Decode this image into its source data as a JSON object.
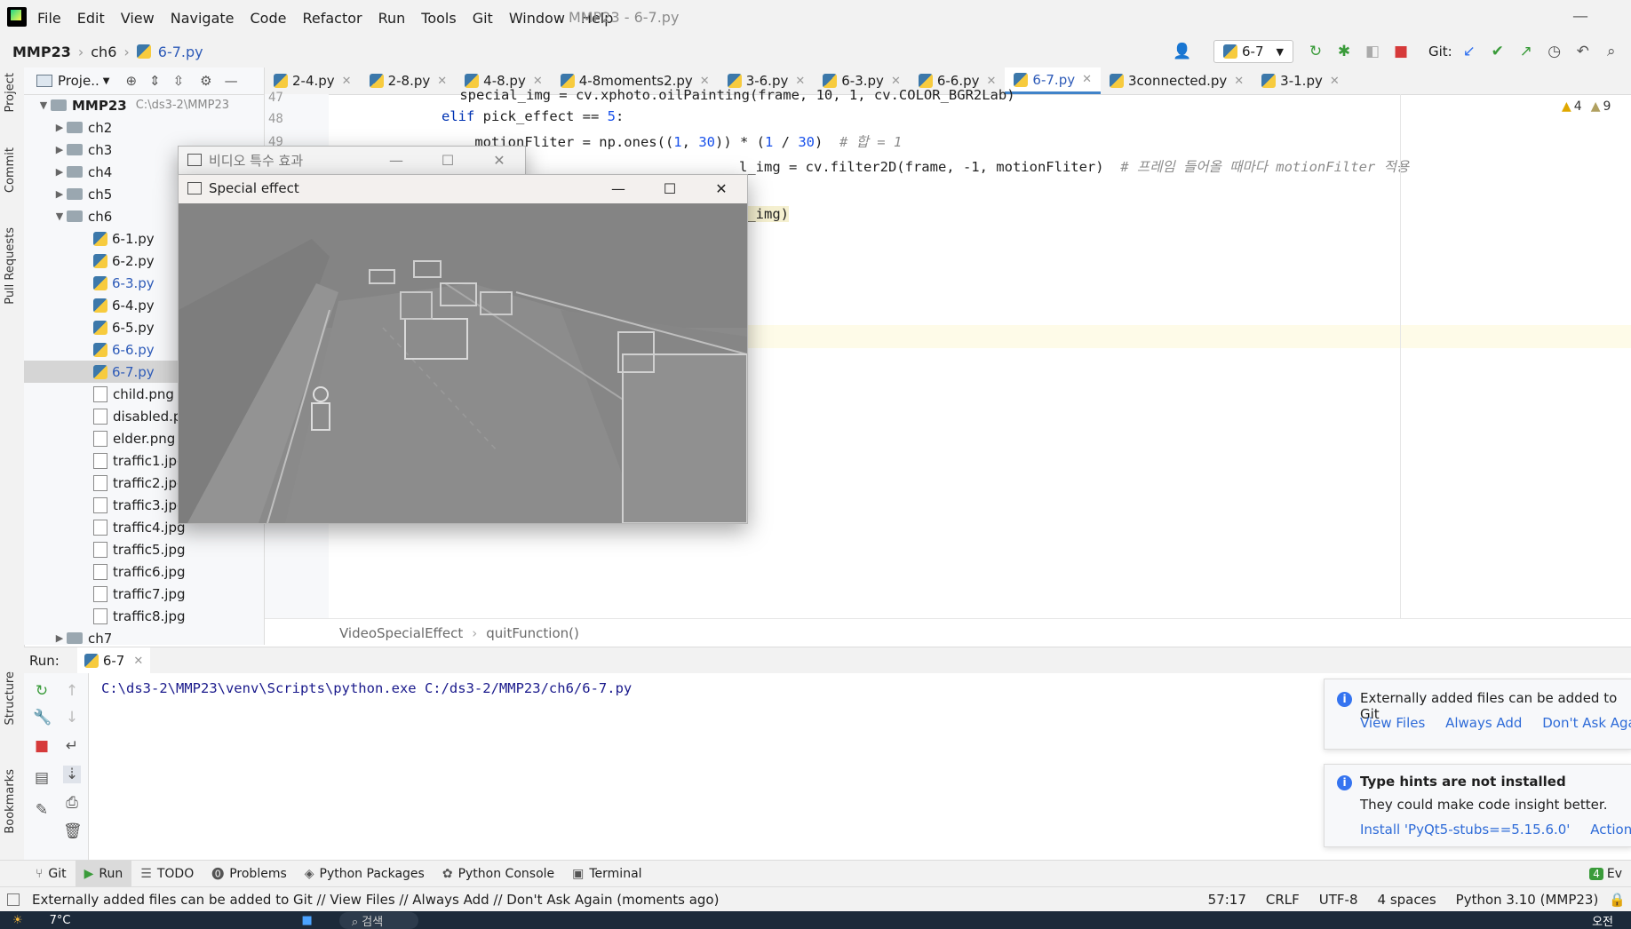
{
  "menubar": {
    "items": [
      "File",
      "Edit",
      "View",
      "Navigate",
      "Code",
      "Refactor",
      "Run",
      "Tools",
      "Git",
      "Window",
      "Help"
    ],
    "window_title": "MMP23 - 6-7.py"
  },
  "navbar": {
    "crumbs": [
      "MMP23",
      "ch6",
      "6-7.py"
    ],
    "run_config": "6-7",
    "git_label": "Git:"
  },
  "left_strip": {
    "project": "Project",
    "commit": "Commit",
    "pull_requests": "Pull Requests",
    "structure": "Structure",
    "bookmarks": "Bookmarks"
  },
  "project_panel": {
    "title": "Proje..",
    "root": {
      "name": "MMP23",
      "path": "C:\\ds3-2\\MMP23"
    },
    "folders_top": [
      "ch2",
      "ch3",
      "ch4",
      "ch5",
      "ch6"
    ],
    "files": [
      {
        "name": "6-1.py",
        "kind": "py",
        "modified": false
      },
      {
        "name": "6-2.py",
        "kind": "py",
        "modified": false
      },
      {
        "name": "6-3.py",
        "kind": "py",
        "modified": true
      },
      {
        "name": "6-4.py",
        "kind": "py",
        "modified": false
      },
      {
        "name": "6-5.py",
        "kind": "py",
        "modified": false
      },
      {
        "name": "6-6.py",
        "kind": "py",
        "modified": true
      },
      {
        "name": "6-7.py",
        "kind": "py",
        "modified": true,
        "selected": true
      },
      {
        "name": "child.png",
        "kind": "img",
        "modified": false
      },
      {
        "name": "disabled.pr",
        "kind": "img",
        "modified": false
      },
      {
        "name": "elder.png",
        "kind": "img",
        "modified": false
      },
      {
        "name": "traffic1.jpg",
        "kind": "img",
        "modified": false
      },
      {
        "name": "traffic2.jpg",
        "kind": "img",
        "modified": false
      },
      {
        "name": "traffic3.jpg",
        "kind": "img",
        "modified": false
      },
      {
        "name": "traffic4.jpg",
        "kind": "img",
        "modified": false
      },
      {
        "name": "traffic5.jpg",
        "kind": "img",
        "modified": false
      },
      {
        "name": "traffic6.jpg",
        "kind": "img",
        "modified": false
      },
      {
        "name": "traffic7.jpg",
        "kind": "img",
        "modified": false
      },
      {
        "name": "traffic8.jpg",
        "kind": "img",
        "modified": false
      }
    ],
    "folder_bottom": "ch7"
  },
  "tabs": [
    {
      "label": "2-4.py",
      "active": false
    },
    {
      "label": "2-8.py",
      "active": false
    },
    {
      "label": "4-8.py",
      "active": false
    },
    {
      "label": "4-8moments2.py",
      "active": false
    },
    {
      "label": "3-6.py",
      "active": false
    },
    {
      "label": "6-3.py",
      "active": false
    },
    {
      "label": "6-6.py",
      "active": false
    },
    {
      "label": "6-7.py",
      "active": true
    },
    {
      "label": "3connected.py",
      "active": false
    },
    {
      "label": "3-1.py",
      "active": false
    }
  ],
  "editor": {
    "line_numbers": [
      "47",
      "48",
      "49"
    ],
    "lines": {
      "l47": "    special_img = cv.xphoto.oilPainting(frame, 10, 1, cv.COLOR_BGR2Lab)",
      "l48_kw": "elif",
      "l48_rest": " pick_effect == ",
      "l48_num": "5",
      "l48_end": ":",
      "l49_a": "    motionFliter = np.ones((",
      "l49_n1": "1",
      "l49_b": ", ",
      "l49_n2": "30",
      "l49_c": ")) * (",
      "l49_n3": "1",
      "l49_d": " / ",
      "l49_n4": "30",
      "l49_e": ")  ",
      "l49_cmt": "# 합 = 1",
      "l50_a": "l_img = cv.filter2D(frame, -1, motionFliter)  ",
      "l50_cmt": "# 프레임 들어올 때마다 motionFilter 적용",
      "l52": "l_img)"
    },
    "warnings": "4",
    "weak_warnings": "9"
  },
  "editor_breadcrumb": [
    "VideoSpecialEffect",
    "quitFunction()"
  ],
  "window_back": {
    "title": "비디오 특수 효과"
  },
  "window_front": {
    "title": "Special effect"
  },
  "run_panel": {
    "label": "Run:",
    "tab": "6-7",
    "command": "C:\\ds3-2\\MMP23\\venv\\Scripts\\python.exe C:/ds3-2/MMP23/ch6/6-7.py"
  },
  "notifications": [
    {
      "title": "Externally added files can be added to Git",
      "body": "",
      "actions": [
        "View Files",
        "Always Add",
        "Don't Ask Again"
      ]
    },
    {
      "title": "Type hints are not installed",
      "body": "They could make code insight better.",
      "actions": [
        "Install 'PyQt5-stubs==5.15.6.0'",
        "Actions"
      ]
    }
  ],
  "bottom_tools": [
    "Git",
    "Run",
    "TODO",
    "Problems",
    "Python Packages",
    "Python Console",
    "Terminal"
  ],
  "event_log_badge": "4",
  "event_log_label": "Ev",
  "status": {
    "message": "Externally added files can be added to Git // View Files // Always Add // Don't Ask Again (moments ago)",
    "position": "57:17",
    "line_sep": "CRLF",
    "encoding": "UTF-8",
    "indent": "4 spaces",
    "interpreter": "Python 3.10 (MMP23)"
  },
  "taskbar": {
    "temperature": "7°C",
    "search_placeholder": "검색",
    "clock_partial": "오전"
  }
}
